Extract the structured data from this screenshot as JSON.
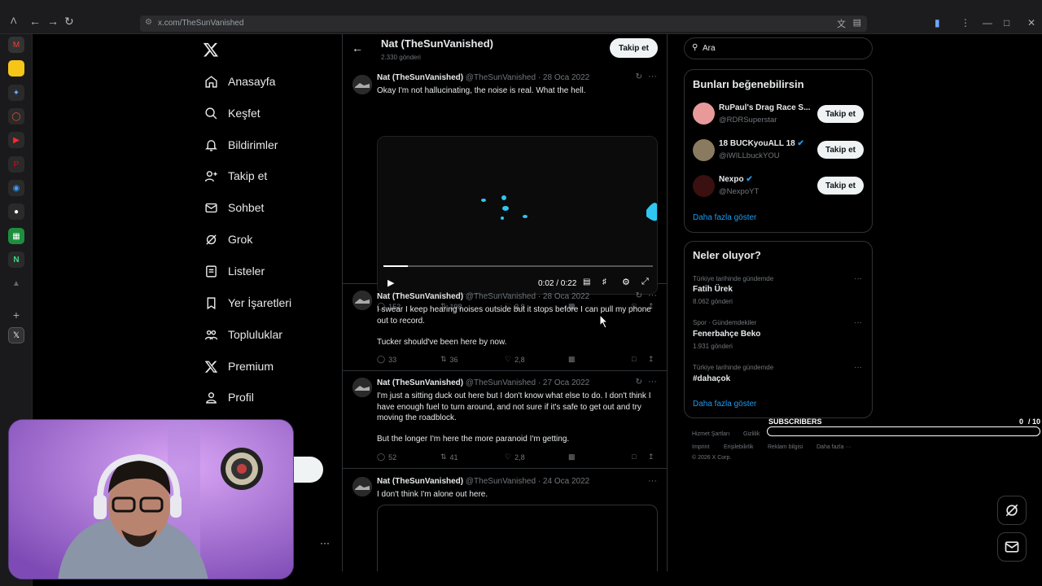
{
  "browser": {
    "url": "x.com/TheSunVanished"
  },
  "nav": {
    "items": [
      {
        "label": "Anasayfa",
        "icon": "home-icon"
      },
      {
        "label": "Keşfet",
        "icon": "search-icon"
      },
      {
        "label": "Bildirimler",
        "icon": "bell-icon"
      },
      {
        "label": "Takip et",
        "icon": "add-person-icon"
      },
      {
        "label": "Sohbet",
        "icon": "mail-icon"
      },
      {
        "label": "Grok",
        "icon": "grok-icon"
      },
      {
        "label": "Listeler",
        "icon": "list-icon"
      },
      {
        "label": "Yer İşaretleri",
        "icon": "bookmark-icon"
      },
      {
        "label": "Topluluklar",
        "icon": "communities-icon"
      },
      {
        "label": "Premium",
        "icon": "x-logo-icon"
      },
      {
        "label": "Profil",
        "icon": "person-icon"
      }
    ]
  },
  "profile": {
    "name": "Nat (TheSunVanished)",
    "post_count": "2.330 gönderi",
    "follow_label": "Takip et"
  },
  "tweets": [
    {
      "name": "Nat (TheSunVanished)",
      "meta": "@TheSunVanished · 28 Oca 2022",
      "text": "Okay I'm not hallucinating, the noise is real. What the hell.",
      "video_time": "0:02 / 0:22",
      "video_progress": 0.09,
      "replies": "152",
      "retweets": "198",
      "likes": "3,8",
      "views": ""
    },
    {
      "name": "Nat (TheSunVanished)",
      "meta": "@TheSunVanished · 28 Oca 2022",
      "text": "I swear I keep hearing noises outside but it stops before I can pull my phone out to record.",
      "text2": "Tucker should've been here by now.",
      "replies": "33",
      "retweets": "36",
      "likes": "2,8",
      "views": ""
    },
    {
      "name": "Nat (TheSunVanished)",
      "meta": "@TheSunVanished · 27 Oca 2022",
      "text": "I'm just a sitting duck out here but I don't know what else to do. I don't think I have enough fuel to turn around, and not sure if it's safe to get out and try moving the roadblock.",
      "text2": "But the longer I'm here the more paranoid I'm getting.",
      "replies": "52",
      "retweets": "41",
      "likes": "2,8",
      "views": ""
    },
    {
      "name": "Nat (TheSunVanished)",
      "meta": "@TheSunVanished · 24 Oca 2022",
      "text": "I don't think I'm alone out here."
    }
  ],
  "search": {
    "placeholder": "Ara"
  },
  "suggestions": {
    "title": "Bunları beğenebilirsin",
    "follow_label": "Takip et",
    "show_more": "Daha fazla göster",
    "items": [
      {
        "name": "RuPaul's Drag Race S...",
        "handle": "@RDRSuperstar",
        "verified": false,
        "color": "#e89a9a"
      },
      {
        "name": "18 BUCKyouALL 18",
        "handle": "@iWILLbuckYOU",
        "verified": true,
        "color": "#8a7a60"
      },
      {
        "name": "Nexpo",
        "handle": "@NexpoYT",
        "verified": true,
        "color": "#3a1010"
      }
    ]
  },
  "trends": {
    "title": "Neler oluyor?",
    "show_more": "Daha fazla göster",
    "items": [
      {
        "meta": "Türkiye tarihinde gündemde",
        "title": "Fatih Ürek",
        "count": "8.062 gönderi"
      },
      {
        "meta": "Spor · Gündemdekiler",
        "title": "Fenerbahçe Beko",
        "count": "1.931 gönderi"
      },
      {
        "meta": "Türkiye tarihinde gündemde",
        "title": "#dahaçok",
        "count": ""
      }
    ]
  },
  "footer": {
    "links": [
      "Hizmet Şartları",
      "Gizlilik",
      "Imprint",
      "Erişilebilirlik",
      "Reklam bilgisi",
      "Daha fazla ···"
    ],
    "copyright": "© 2026 X Corp."
  },
  "overlay": {
    "subscribers_label": "SUBSCRIBERS",
    "subscribers_count": "0",
    "subscribers_goal": "/ 10",
    "subscribers_progress": 0
  },
  "colors": {
    "background": "#000000",
    "text": "#e7e9ea",
    "muted": "#71767b",
    "accent": "#1d9bf0",
    "border": "#2f3336"
  }
}
